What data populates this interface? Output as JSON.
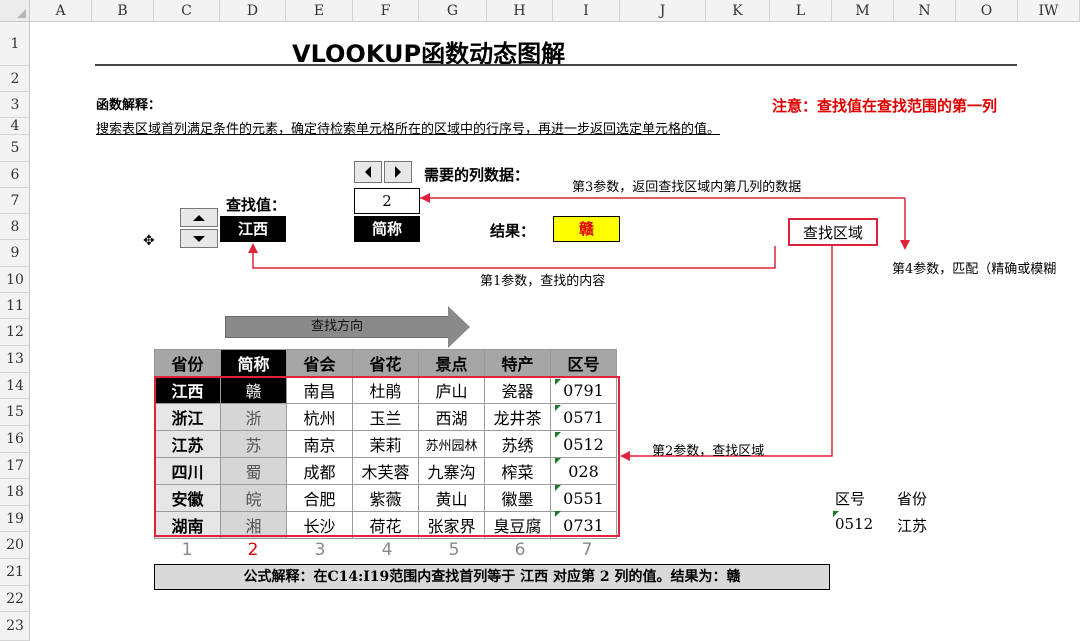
{
  "sheet": {
    "columns": [
      "A",
      "B",
      "C",
      "D",
      "E",
      "F",
      "G",
      "H",
      "I",
      "J",
      "K",
      "L",
      "M",
      "N",
      "O",
      "IW"
    ],
    "rows": [
      "1",
      "2",
      "3",
      "4",
      "5",
      "6",
      "7",
      "8",
      "9",
      "10",
      "11",
      "12",
      "13",
      "14",
      "15",
      "16",
      "17",
      "18",
      "19",
      "20",
      "21",
      "22",
      "23"
    ]
  },
  "title": "VLOOKUP函数动态图解",
  "explain": {
    "heading": "函数解释：",
    "text": "搜索表区域首列满足条件的元素，确定待检索单元格所在的区域中的行序号，再进一步返回选定单元格的值。"
  },
  "note": "注意：查找值在查找范围的第一列",
  "lookup": {
    "label": "查找值：",
    "value": "江西"
  },
  "column_select": {
    "label": "需要的列数据：",
    "number": "2",
    "name": "简称"
  },
  "result": {
    "label": "结果：",
    "value": "赣"
  },
  "range_box": "查找区域",
  "annotations": {
    "param3": "第3参数，返回查找区域内第几列的数据",
    "param1": "第1参数，查找的内容",
    "param4": "第4参数，匹配（精确或模糊",
    "param2": "第2参数，查找区域",
    "direction": "查找方向"
  },
  "table": {
    "headers": [
      "省份",
      "简称",
      "省会",
      "省花",
      "景点",
      "特产",
      "区号"
    ],
    "rows": [
      [
        "江西",
        "赣",
        "南昌",
        "杜鹃",
        "庐山",
        "瓷器",
        "0791"
      ],
      [
        "浙江",
        "浙",
        "杭州",
        "玉兰",
        "西湖",
        "龙井茶",
        "0571"
      ],
      [
        "江苏",
        "苏",
        "南京",
        "茉莉",
        "苏州园林",
        "苏绣",
        "0512"
      ],
      [
        "四川",
        "蜀",
        "成都",
        "木芙蓉",
        "九寨沟",
        "榨菜",
        "028"
      ],
      [
        "安徽",
        "皖",
        "合肥",
        "紫薇",
        "黄山",
        "徽墨",
        "0551"
      ],
      [
        "湖南",
        "湘",
        "长沙",
        "荷花",
        "张家界",
        "臭豆腐",
        "0731"
      ]
    ],
    "col_numbers": [
      "1",
      "2",
      "3",
      "4",
      "5",
      "6",
      "7"
    ]
  },
  "formula": "公式解释：在C14:I19范围内查找首列等于 江西 对应第 2 列的值。结果为：赣",
  "mini_table": {
    "headers": [
      "区号",
      "省份"
    ],
    "row": [
      "0512",
      "江苏"
    ]
  },
  "colors": {
    "accent_red": "#e0223c",
    "result_yellow": "#ffff00"
  }
}
